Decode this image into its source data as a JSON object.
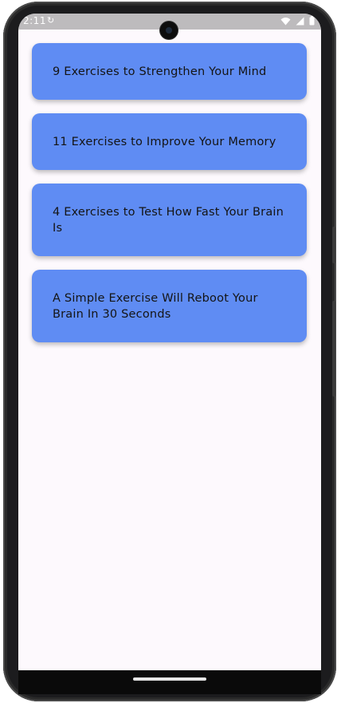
{
  "status_bar": {
    "time": "2:11",
    "notification_icon": "sync-icon",
    "wifi_icon": "wifi-icon",
    "signal_icon": "cellular-signal-icon",
    "battery_icon": "battery-icon"
  },
  "cards": [
    {
      "title": "9 Exercises to Strengthen Your Mind"
    },
    {
      "title": "11 Exercises to Improve Your Memory"
    },
    {
      "title": "4 Exercises to Test How Fast Your Brain Is"
    },
    {
      "title": "A Simple Exercise Will Reboot Your Brain In 30 Seconds"
    }
  ],
  "colors": {
    "card_background": "#5f8cf3",
    "screen_background": "#fdf9fd",
    "status_bar_background": "#bdbbbd"
  }
}
